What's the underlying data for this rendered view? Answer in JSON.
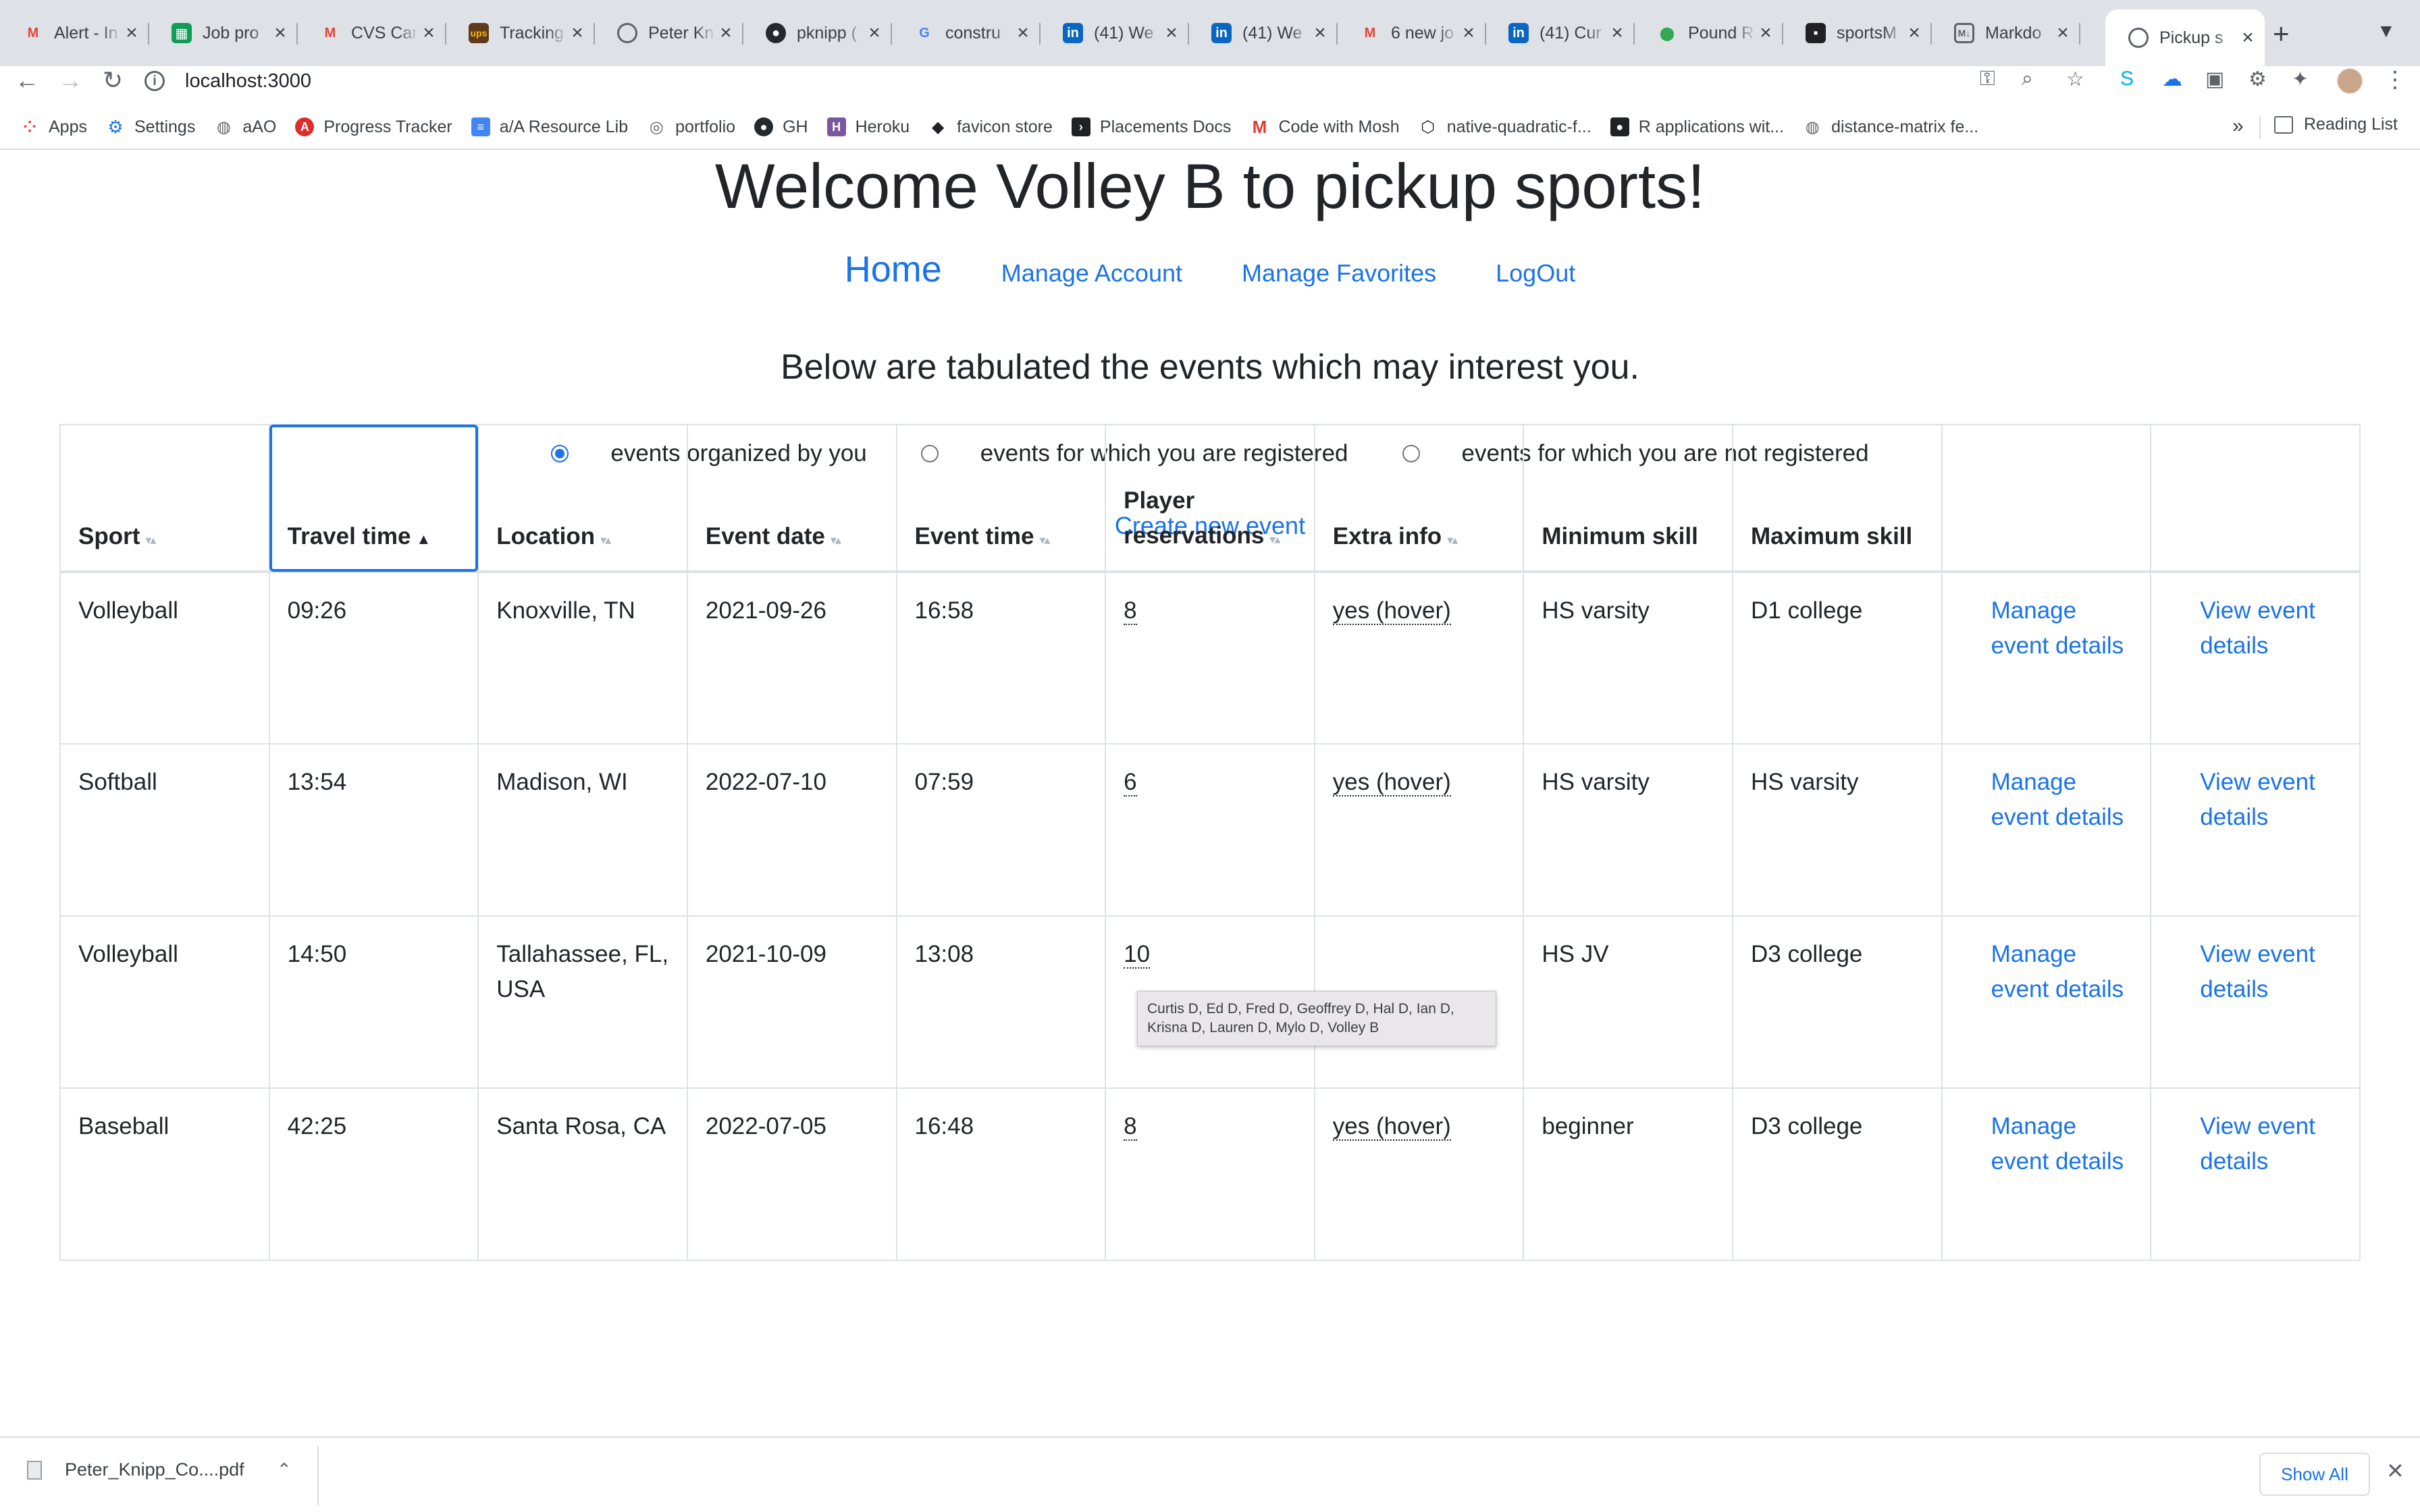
{
  "browser": {
    "tabs": [
      {
        "title": "Alert - In",
        "icon": "gmail-icon",
        "color": "#ea4335"
      },
      {
        "title": "Job pro",
        "icon": "sheets-icon",
        "color": "#0f9d58"
      },
      {
        "title": "CVS Car",
        "icon": "gmail-icon",
        "color": "#ea4335"
      },
      {
        "title": "Tracking",
        "icon": "ups-icon",
        "color": "#5e3a1a"
      },
      {
        "title": "Peter Kn",
        "icon": "site-icon",
        "color": "#5f6368"
      },
      {
        "title": "pknipp (",
        "icon": "github-icon",
        "color": "#24292e"
      },
      {
        "title": "constru",
        "icon": "google-icon",
        "color": "#4285f4"
      },
      {
        "title": "(41) We",
        "icon": "linkedin-icon",
        "color": "#0a66c2"
      },
      {
        "title": "(41) We",
        "icon": "linkedin-icon",
        "color": "#0a66c2"
      },
      {
        "title": "6 new jo",
        "icon": "gmail-icon",
        "color": "#ea4335"
      },
      {
        "title": "(41) Cur",
        "icon": "linkedin-icon",
        "color": "#0a66c2"
      },
      {
        "title": "Pound R",
        "icon": "maps-icon",
        "color": "#34a853"
      },
      {
        "title": "sportsM",
        "icon": "app-icon",
        "color": "#202124"
      },
      {
        "title": "Markdo",
        "icon": "markdown-icon",
        "color": "#5f6368"
      },
      {
        "title": "Pickup s",
        "icon": "site-icon",
        "color": "#5f6368"
      }
    ],
    "url": "localhost:3000",
    "bookmarks": [
      {
        "label": "Apps",
        "icon": "apps-grid-icon",
        "color": "#ea4335"
      },
      {
        "label": "Settings",
        "icon": "gear-icon",
        "color": "#1a73e8"
      },
      {
        "label": "aAO",
        "icon": "globe-icon",
        "color": "#5f6368"
      },
      {
        "label": "Progress Tracker",
        "icon": "angular-icon",
        "color": "#dd2c2c"
      },
      {
        "label": "a/A Resource Lib",
        "icon": "docs-icon",
        "color": "#4285f4"
      },
      {
        "label": "portfolio",
        "icon": "site-icon",
        "color": "#5f6368"
      },
      {
        "label": "GH",
        "icon": "github-icon",
        "color": "#24292e"
      },
      {
        "label": "Heroku",
        "icon": "heroku-icon",
        "color": "#79589f"
      },
      {
        "label": "favicon store",
        "icon": "favicon-icon",
        "color": "#5f6368"
      },
      {
        "label": "Placements Docs",
        "icon": "terminal-icon",
        "color": "#202124"
      },
      {
        "label": "Code with Mosh",
        "icon": "mosh-icon",
        "color": "#3b5998"
      },
      {
        "label": "native-quadratic-f...",
        "icon": "codesandbox-icon",
        "color": "#5f6368"
      },
      {
        "label": "R applications wit...",
        "icon": "r-icon",
        "color": "#202124"
      },
      {
        "label": "distance-matrix fe...",
        "icon": "globe-icon",
        "color": "#5f6368"
      }
    ],
    "more_label": "»",
    "reading_list": "Reading List"
  },
  "page": {
    "welcome": "Welcome Volley B to pickup sports!",
    "nav": {
      "home": "Home",
      "manage_account": "Manage Account",
      "manage_favorites": "Manage Favorites",
      "logout": "LogOut"
    },
    "subtitle": "Below are tabulated the events which may interest you.",
    "filters": [
      {
        "label": "events organized by you",
        "checked": true
      },
      {
        "label": "events for which you are registered",
        "checked": false
      },
      {
        "label": "events for which you are not registered",
        "checked": false
      }
    ],
    "create_event": "Create new event",
    "table": {
      "headers": [
        "Sport",
        "Travel time",
        "Location",
        "Event date",
        "Event time",
        "Player reservations",
        "Extra info",
        "Minimum skill",
        "Maximum skill",
        "",
        ""
      ],
      "rows": [
        {
          "sport": "Volleyball",
          "travel": "09:26",
          "location": "Knoxville, TN",
          "date": "2021-09-26",
          "time": "16:58",
          "reservations": "8",
          "extra": "yes (hover)",
          "min": "HS varsity",
          "max": "D1 college",
          "manage": "Manage event details",
          "view": "View event details"
        },
        {
          "sport": "Softball",
          "travel": "13:54",
          "location": "Madison, WI",
          "date": "2022-07-10",
          "time": "07:59",
          "reservations": "6",
          "extra": "yes (hover)",
          "min": "HS varsity",
          "max": "HS varsity",
          "manage": "Manage event details",
          "view": "View event details"
        },
        {
          "sport": "Volleyball",
          "travel": "14:50",
          "location": "Tallahassee, FL, USA",
          "date": "2021-10-09",
          "time": "13:08",
          "reservations": "10",
          "extra": "",
          "min": "HS JV",
          "max": "D3 college",
          "manage": "Manage event details",
          "view": "View event details"
        },
        {
          "sport": "Baseball",
          "travel": "42:25",
          "location": "Santa Rosa, CA",
          "date": "2022-07-05",
          "time": "16:48",
          "reservations": "8",
          "extra": "yes (hover)",
          "min": "beginner",
          "max": "D3 college",
          "manage": "Manage event details",
          "view": "View event details"
        }
      ],
      "tooltip": "Curtis D, Ed D, Fred D, Geoffrey D, Hal D, Ian D, Krisna D, Lauren D, Mylo D, Volley B"
    }
  },
  "downloads": {
    "file": "Peter_Knipp_Co....pdf",
    "show_all": "Show All"
  }
}
